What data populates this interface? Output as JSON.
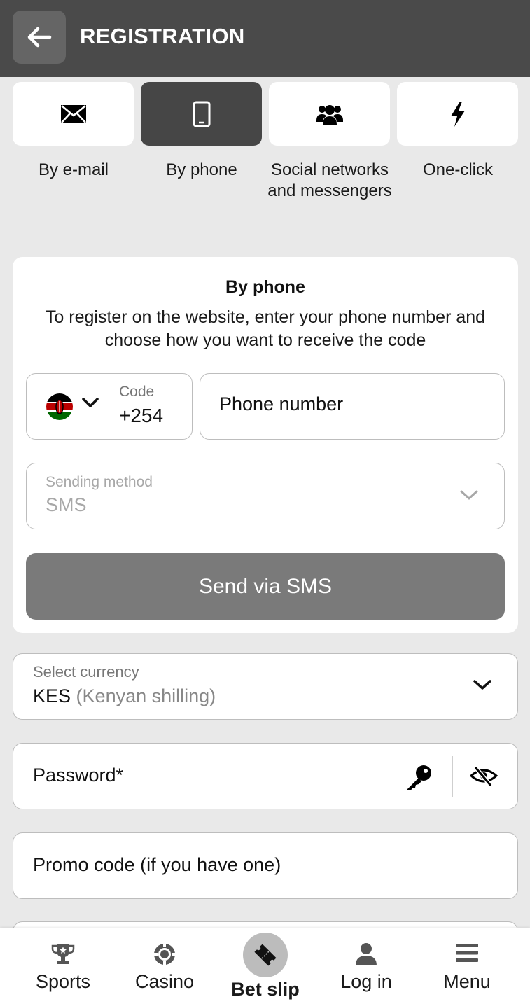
{
  "header": {
    "title": "REGISTRATION",
    "back_icon": "arrow-left-icon"
  },
  "methods": [
    {
      "label": "By e-mail",
      "icon": "envelope-icon",
      "active": false
    },
    {
      "label": "By phone",
      "icon": "smartphone-icon",
      "active": true
    },
    {
      "label": "Social networks and messengers",
      "icon": "users-icon",
      "active": false
    },
    {
      "label": "One-click",
      "icon": "lightning-icon",
      "active": false
    }
  ],
  "phone_card": {
    "title": "By phone",
    "description": "To register on the website, enter your phone number and choose how you want to receive the code",
    "code_label": "Code",
    "code_value": "+254",
    "country_flag": "kenya-flag-icon",
    "phone_placeholder": "Phone number",
    "sending_method_label": "Sending method",
    "sending_method_value": "SMS",
    "send_button": "Send via SMS"
  },
  "currency": {
    "label": "Select currency",
    "code": "KES",
    "name": "(Kenyan shilling)"
  },
  "password": {
    "placeholder": "Password*"
  },
  "promo": {
    "placeholder": "Promo code (if you have one)"
  },
  "bottom_nav": [
    {
      "label": "Sports",
      "icon": "trophy-icon"
    },
    {
      "label": "Casino",
      "icon": "casino-chip-icon"
    },
    {
      "label": "Bet slip",
      "icon": "ticket-icon"
    },
    {
      "label": "Log in",
      "icon": "user-icon"
    },
    {
      "label": "Menu",
      "icon": "hamburger-menu-icon"
    }
  ],
  "colors": {
    "header_bg": "#4a4a4a",
    "active_tile": "#464646",
    "send_button_bg": "#7a7a7a",
    "page_bg": "#e9e9e9"
  }
}
